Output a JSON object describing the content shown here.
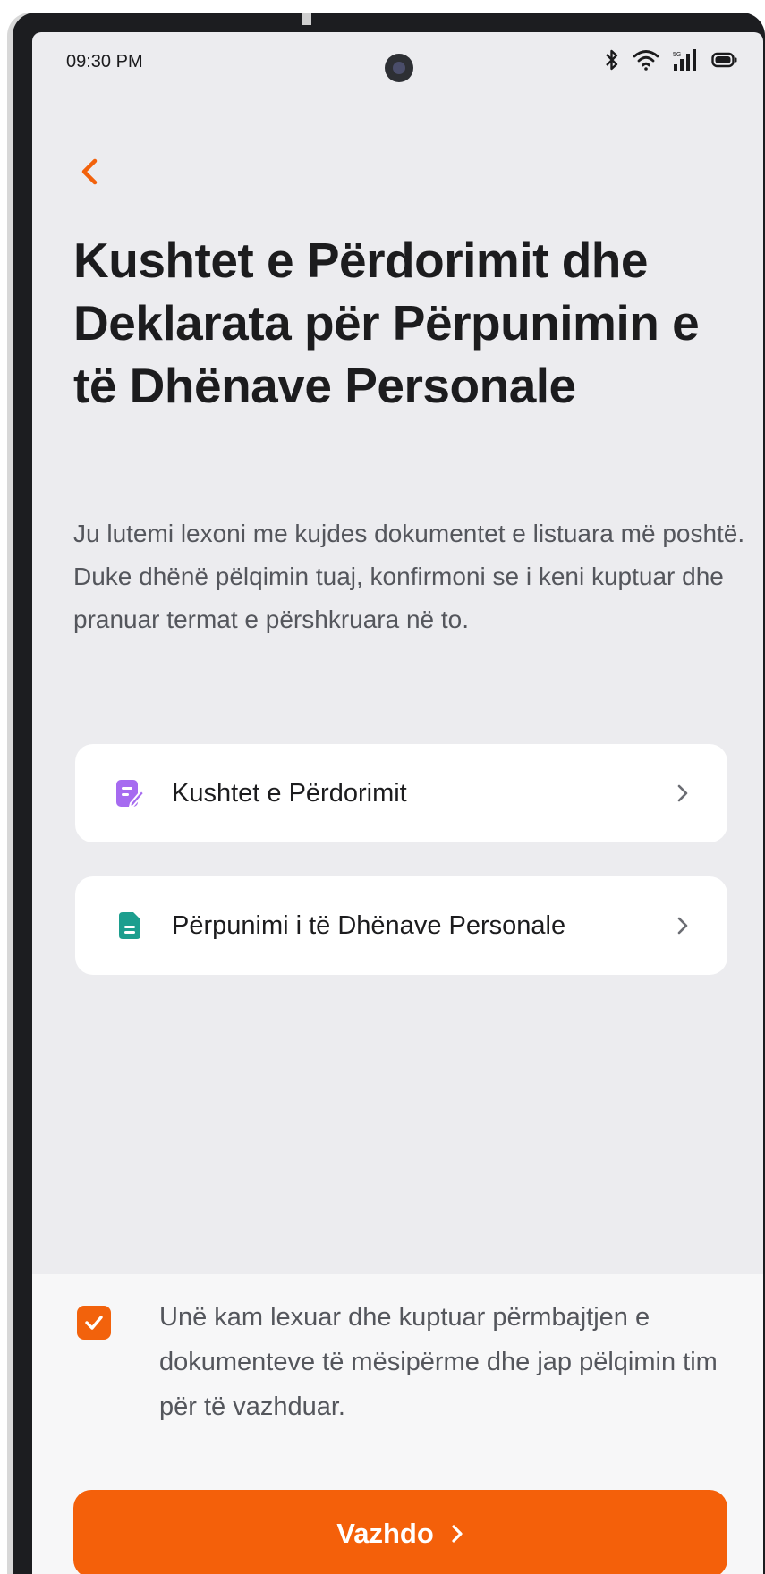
{
  "status_bar": {
    "time": "09:30 PM",
    "icons": [
      "bluetooth-icon",
      "wifi-icon",
      "signal-5g-icon",
      "battery-icon"
    ],
    "network_label": "5G"
  },
  "header": {
    "back_icon": "chevron-left-icon",
    "title": "Kushtet e Përdorimit dhe Deklarata për Përpunimin e të Dhënave Personale",
    "description": "Ju lutemi lexoni me kujdes dokumentet e listuara më poshtë. Duke dhënë pëlqimin tuaj, konfirmoni se i keni kuptuar dhe pranuar termat e përshkruara në to."
  },
  "documents": [
    {
      "label": "Kushtet e Përdorimit",
      "icon": "edit-document-icon",
      "icon_color": "#a66bf0"
    },
    {
      "label": "Përpunimi i të Dhënave Personale",
      "icon": "document-icon",
      "icon_color": "#1c9e8e"
    }
  ],
  "consent": {
    "checked": true,
    "text": "Unë kam lexuar dhe kuptuar përmbajtjen e dokumenteve të mësipërme dhe jap pëlqimin tim për të vazhduar."
  },
  "continue_button": {
    "label": "Vazhdo",
    "icon": "chevron-right-icon"
  },
  "colors": {
    "accent": "#f4600a",
    "background": "#ececef",
    "card": "#ffffff",
    "title": "#1c1c1e",
    "body_text": "#54565c"
  }
}
